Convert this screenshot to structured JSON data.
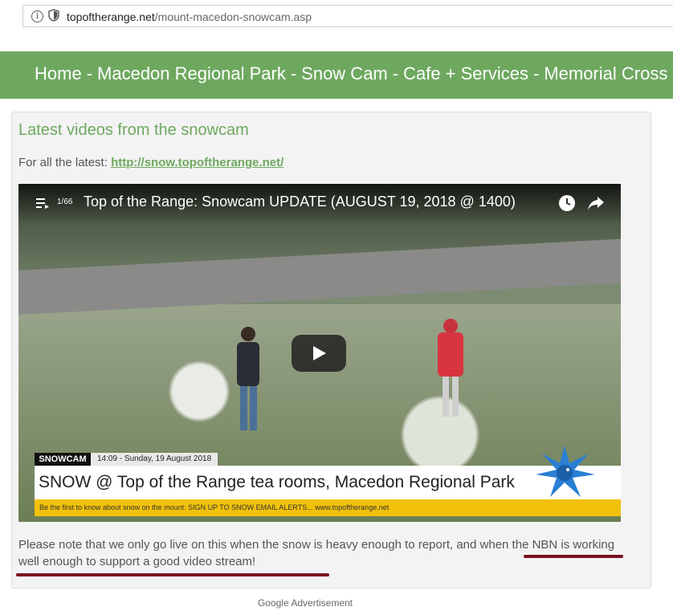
{
  "browser": {
    "url_domain": "topoftherange.net",
    "url_path": "/mount-macedon-snowcam.asp"
  },
  "nav": {
    "items": [
      "Home",
      "Macedon Regional Park",
      "Snow Cam",
      "Cafe + Services",
      "Memorial Cross"
    ],
    "separator": "-",
    "active": "Snow Cam",
    "background": "#6ea85f"
  },
  "main": {
    "heading": "Latest videos from the snowcam",
    "latest_prefix": "For all the latest:",
    "latest_link": "http://snow.topoftherange.net/",
    "note": "Please note that we only go live on this when the snow is heavy enough to report, and when the NBN is working well enough to support a good video stream!"
  },
  "video": {
    "counter": "1/66",
    "title": "Top of the Range: Snowcam UPDATE (AUGUST 19, 2018 @ 1400)",
    "overlay_tag": "SNOWCAM",
    "overlay_date": "14:09 - Sunday, 19 August 2018",
    "overlay_headline": "SNOW @ Top of the Range tea rooms, Macedon Regional Park",
    "overlay_ticker": "Be the first to know about snow on the mount: SIGN UP TO SNOW EMAIL ALERTS... www.topoftherange.net",
    "icons": [
      "playlist-icon",
      "watch-later-icon",
      "share-icon",
      "play-icon"
    ]
  },
  "footer": {
    "ad_label": "Google Advertisement"
  },
  "colors": {
    "accent": "#6ea85f",
    "underline_annotation": "#7a1020"
  }
}
